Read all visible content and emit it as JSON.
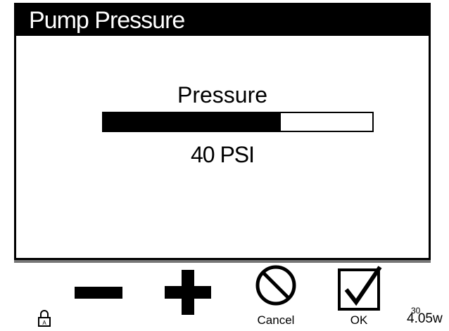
{
  "title": "Pump Pressure",
  "gauge": {
    "label": "Pressure",
    "value_text": "40 PSI",
    "fill_fraction": 0.66
  },
  "buttons": {
    "cancel_label": "Cancel",
    "ok_label": "OK"
  },
  "status": {
    "top": "30",
    "bottom": "4.05w"
  },
  "icons": {
    "minus": "minus-icon",
    "plus": "plus-icon",
    "cancel": "no-entry-icon",
    "ok": "checkbox-check-icon",
    "lock": "lock-icon"
  }
}
